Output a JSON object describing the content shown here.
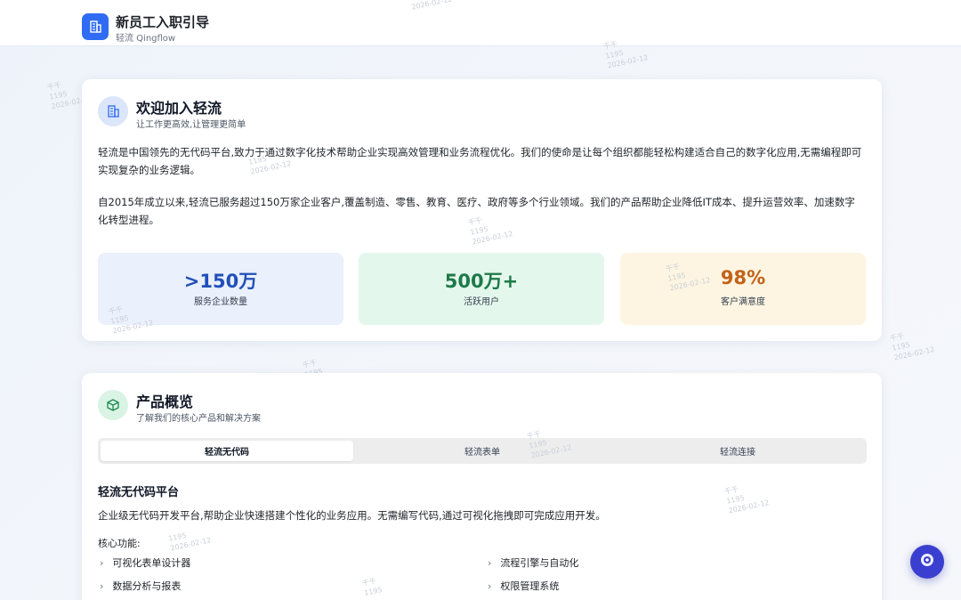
{
  "header": {
    "title": "新员工入职引导",
    "subtitle": "轻流 Qingflow",
    "logo_icon": "building-icon"
  },
  "watermark": {
    "line1": "千千",
    "line2": "1195",
    "line3": "2026-02-12"
  },
  "welcome": {
    "title": "欢迎加入轻流",
    "subtitle": "让工作更高效,让管理更简单",
    "icon": "building-icon",
    "para1": "轻流是中国领先的无代码平台,致力于通过数字化技术帮助企业实现高效管理和业务流程优化。我们的使命是让每个组织都能轻松构建适合自己的数字化应用,无需编程即可实现复杂的业务逻辑。",
    "para2": "自2015年成立以来,轻流已服务超过150万家企业客户,覆盖制造、零售、教育、医疗、政府等多个行业领域。我们的产品帮助企业降低IT成本、提升运营效率、加速数字化转型进程。",
    "stats": [
      {
        "value": ">150万",
        "label": "服务企业数量",
        "color": "#2150b8"
      },
      {
        "value": "500万+",
        "label": "活跃用户",
        "color": "#1d7a48"
      },
      {
        "value": "98%",
        "label": "客户满意度",
        "color": "#c2621a"
      }
    ]
  },
  "product": {
    "title": "产品概览",
    "subtitle": "了解我们的核心产品和解决方案",
    "icon": "cube-icon",
    "tabs": [
      {
        "label": "轻流无代码",
        "active": true
      },
      {
        "label": "轻流表单",
        "active": false
      },
      {
        "label": "轻流连接",
        "active": false
      }
    ],
    "section_title": "轻流无代码平台",
    "section_desc": "企业级无代码开发平台,帮助企业快速搭建个性化的业务应用。无需编写代码,通过可视化拖拽即可完成应用开发。",
    "features_title": "核心功能:",
    "features": [
      "可视化表单设计器",
      "流程引擎与自动化",
      "数据分析与报表",
      "权限管理系统"
    ]
  },
  "float_button": {
    "icon": "assistant-icon"
  },
  "colors": {
    "brand": "#2f6bf3",
    "float": "#3b3fd0"
  }
}
